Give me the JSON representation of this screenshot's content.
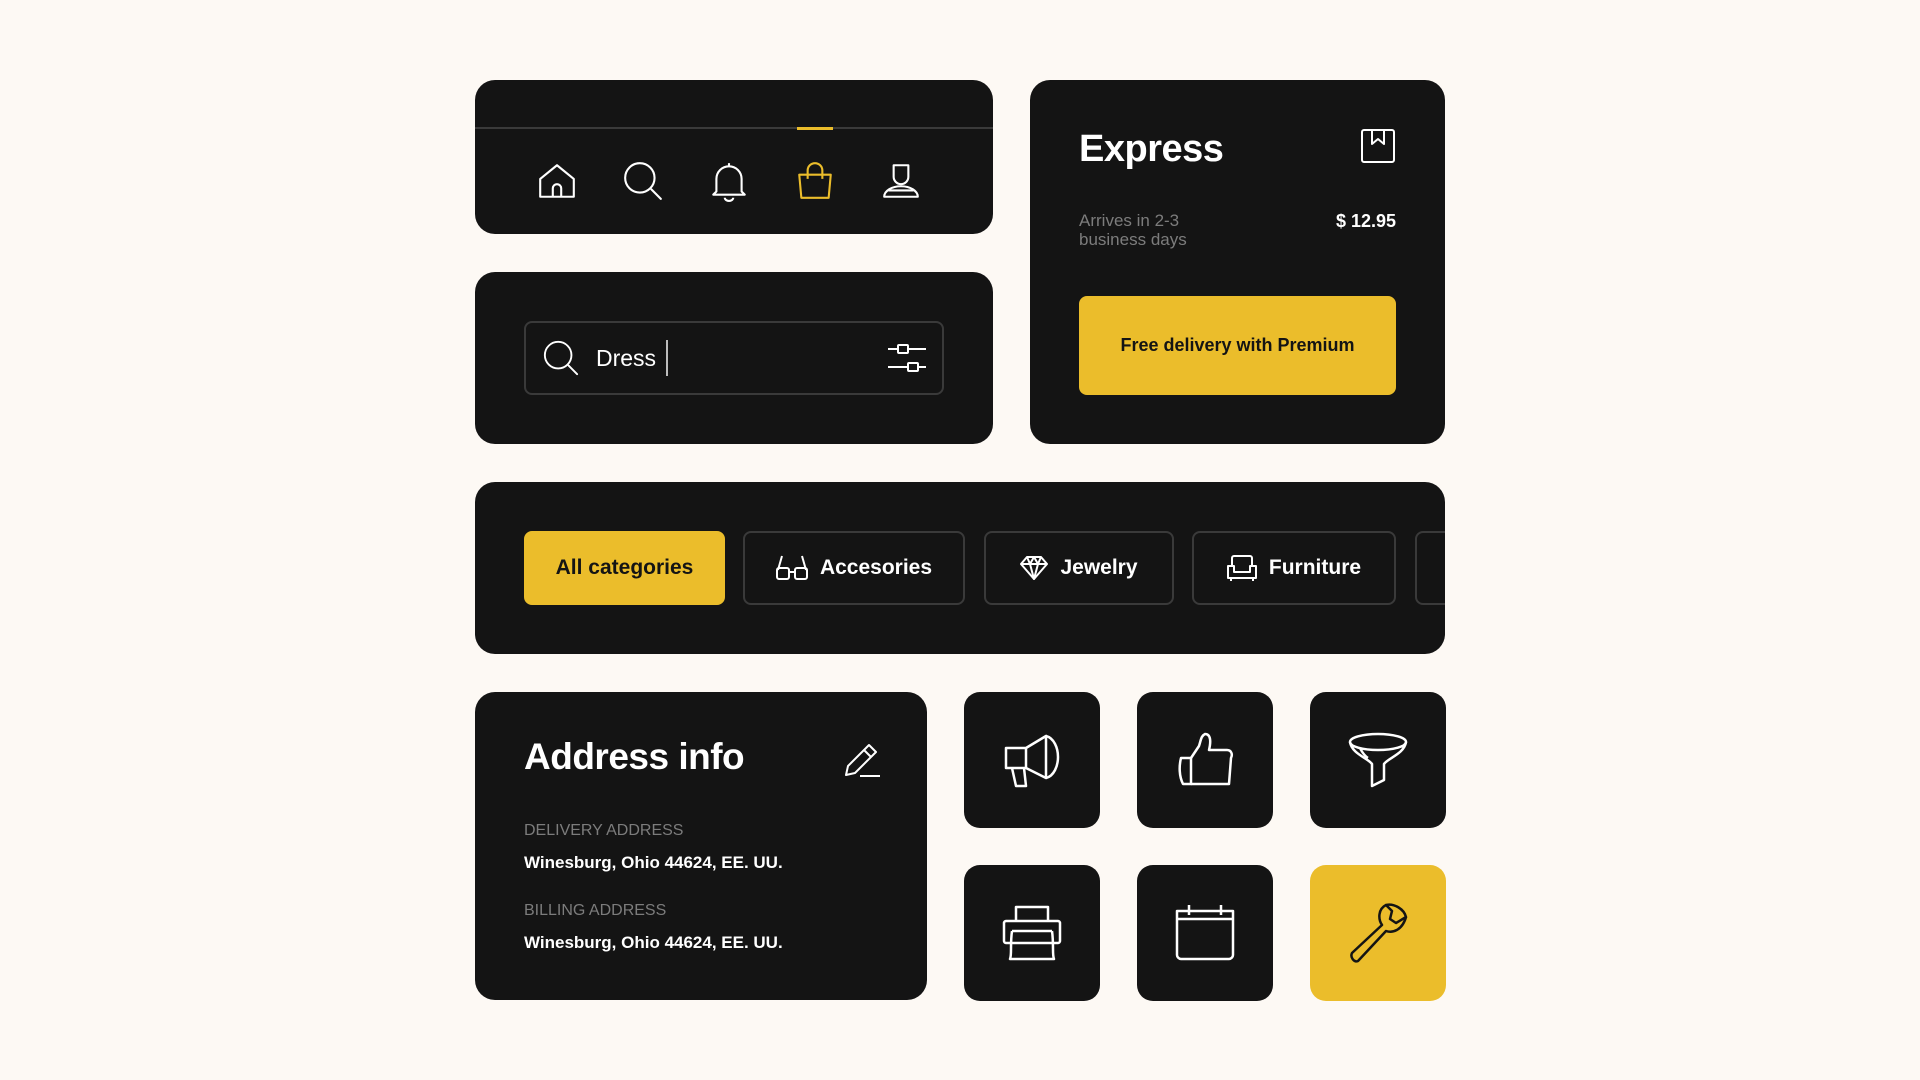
{
  "colors": {
    "background": "#FDF9F4",
    "card": "#141414",
    "accent": "#EBBD2B",
    "border": "#3a3a3a",
    "muted_text": "#7c7c7c",
    "text": "#FFFFFF"
  },
  "nav": {
    "items": [
      {
        "icon": "home-icon",
        "active": false
      },
      {
        "icon": "search-icon",
        "active": false
      },
      {
        "icon": "bell-icon",
        "active": false
      },
      {
        "icon": "shopping-bag-icon",
        "active": true
      },
      {
        "icon": "user-icon",
        "active": false
      }
    ]
  },
  "express": {
    "title": "Express",
    "subtitle": "Arrives in 2-3 business days",
    "price": "$ 12.95",
    "cta_label": "Free delivery with Premium",
    "bookmark_icon": "bookmark-icon"
  },
  "search": {
    "value": "Dress",
    "icon": "search-icon",
    "filter_icon": "filter-sliders-icon"
  },
  "categories": {
    "items": [
      {
        "label": "All categories",
        "icon": "",
        "active": true
      },
      {
        "label": "Accesories",
        "icon": "glasses-icon",
        "active": false
      },
      {
        "label": "Jewelry",
        "icon": "diamond-icon",
        "active": false
      },
      {
        "label": "Furniture",
        "icon": "armchair-icon",
        "active": false
      }
    ]
  },
  "address": {
    "title": "Address info",
    "edit_icon": "pencil-icon",
    "delivery_label": "DELIVERY ADDRESS",
    "delivery_value": "Winesburg, Ohio 44624, EE. UU.",
    "billing_label": "BILLING ADDRESS",
    "billing_value": "Winesburg, Ohio 44624, EE. UU."
  },
  "tiles": [
    {
      "icon": "megaphone-icon",
      "highlighted": false
    },
    {
      "icon": "thumbs-up-icon",
      "highlighted": false
    },
    {
      "icon": "funnel-icon",
      "highlighted": false
    },
    {
      "icon": "printer-icon",
      "highlighted": false
    },
    {
      "icon": "calendar-icon",
      "highlighted": false
    },
    {
      "icon": "wrench-icon",
      "highlighted": true
    }
  ]
}
